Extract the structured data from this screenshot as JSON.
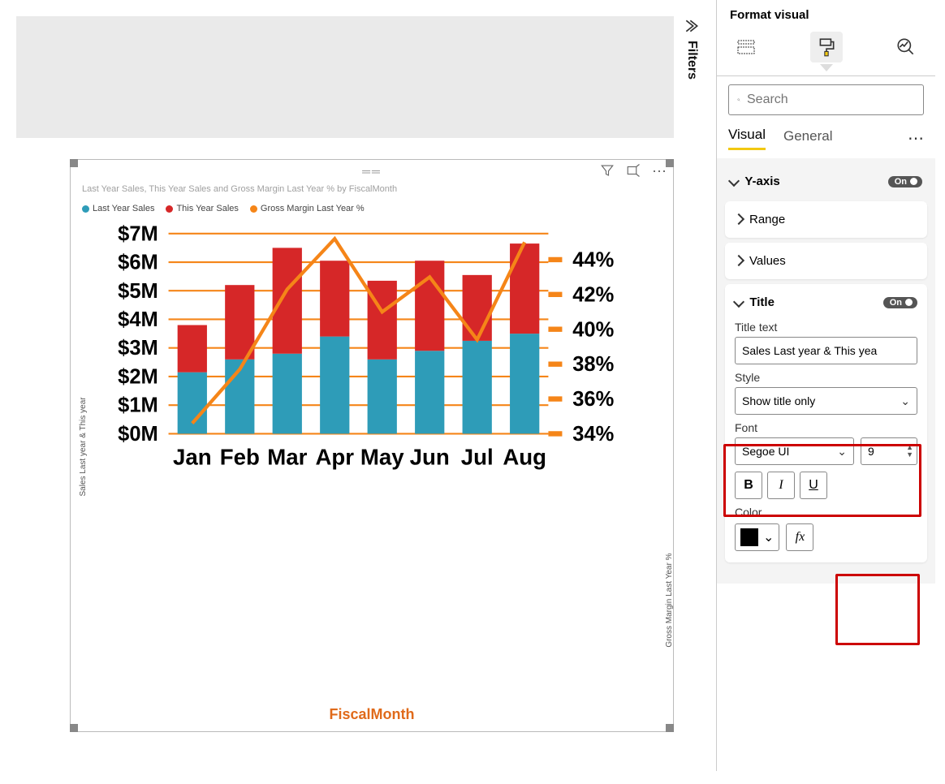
{
  "filters_label": "Filters",
  "panel": {
    "header": "Format visual",
    "search_placeholder": "Search",
    "tabs": [
      "Visual",
      "General"
    ],
    "active_tab": 0,
    "yaxis": {
      "label": "Y-axis",
      "toggle": "On",
      "sub": [
        "Range",
        "Values"
      ]
    },
    "title_section": {
      "label": "Title",
      "toggle": "On",
      "title_text_label": "Title text",
      "title_text_value": "Sales Last year & This yea",
      "style_label": "Style",
      "style_value": "Show title only",
      "font_label": "Font",
      "font_family": "Segoe UI",
      "font_size": "9",
      "color_label": "Color",
      "fx": "fx",
      "bold": "B",
      "italic": "I",
      "underline": "U"
    }
  },
  "visual": {
    "title": "Last Year Sales, This Year Sales and Gross Margin Last Year % by FiscalMonth",
    "legend": [
      "Last Year Sales",
      "This Year Sales",
      "Gross Margin Last Year %"
    ],
    "xlabel": "FiscalMonth",
    "ylabel_left": "Sales Last year & This year",
    "ylabel_right": "Gross Margin Last Year %"
  },
  "chart_data": {
    "type": "bar",
    "categories": [
      "Jan",
      "Feb",
      "Mar",
      "Apr",
      "May",
      "Jun",
      "Jul",
      "Aug"
    ],
    "series": [
      {
        "name": "Last Year Sales",
        "color": "#2e9cb8",
        "values": [
          2.15,
          2.6,
          2.8,
          3.4,
          2.6,
          2.9,
          3.25,
          3.5
        ]
      },
      {
        "name": "This Year Sales",
        "color": "#d62728",
        "values": [
          1.65,
          2.6,
          3.7,
          2.65,
          2.75,
          3.15,
          2.3,
          3.15
        ]
      }
    ],
    "line": {
      "name": "Gross Margin Last Year %",
      "color": "#f58518",
      "values": [
        34.6,
        37.7,
        42.3,
        45.2,
        41.0,
        43.0,
        39.4,
        45.0
      ]
    },
    "y_left": {
      "ticks": [
        0,
        1,
        2,
        3,
        4,
        5,
        6,
        7
      ],
      "labels": [
        "$0M",
        "$1M",
        "$2M",
        "$3M",
        "$4M",
        "$5M",
        "$6M",
        "$7M"
      ],
      "min": 0,
      "max": 7
    },
    "y_right": {
      "ticks": [
        34,
        36,
        38,
        40,
        42,
        44
      ],
      "labels": [
        "34%",
        "36%",
        "38%",
        "40%",
        "42%",
        "44%"
      ],
      "min": 34,
      "max": 45.5
    }
  }
}
